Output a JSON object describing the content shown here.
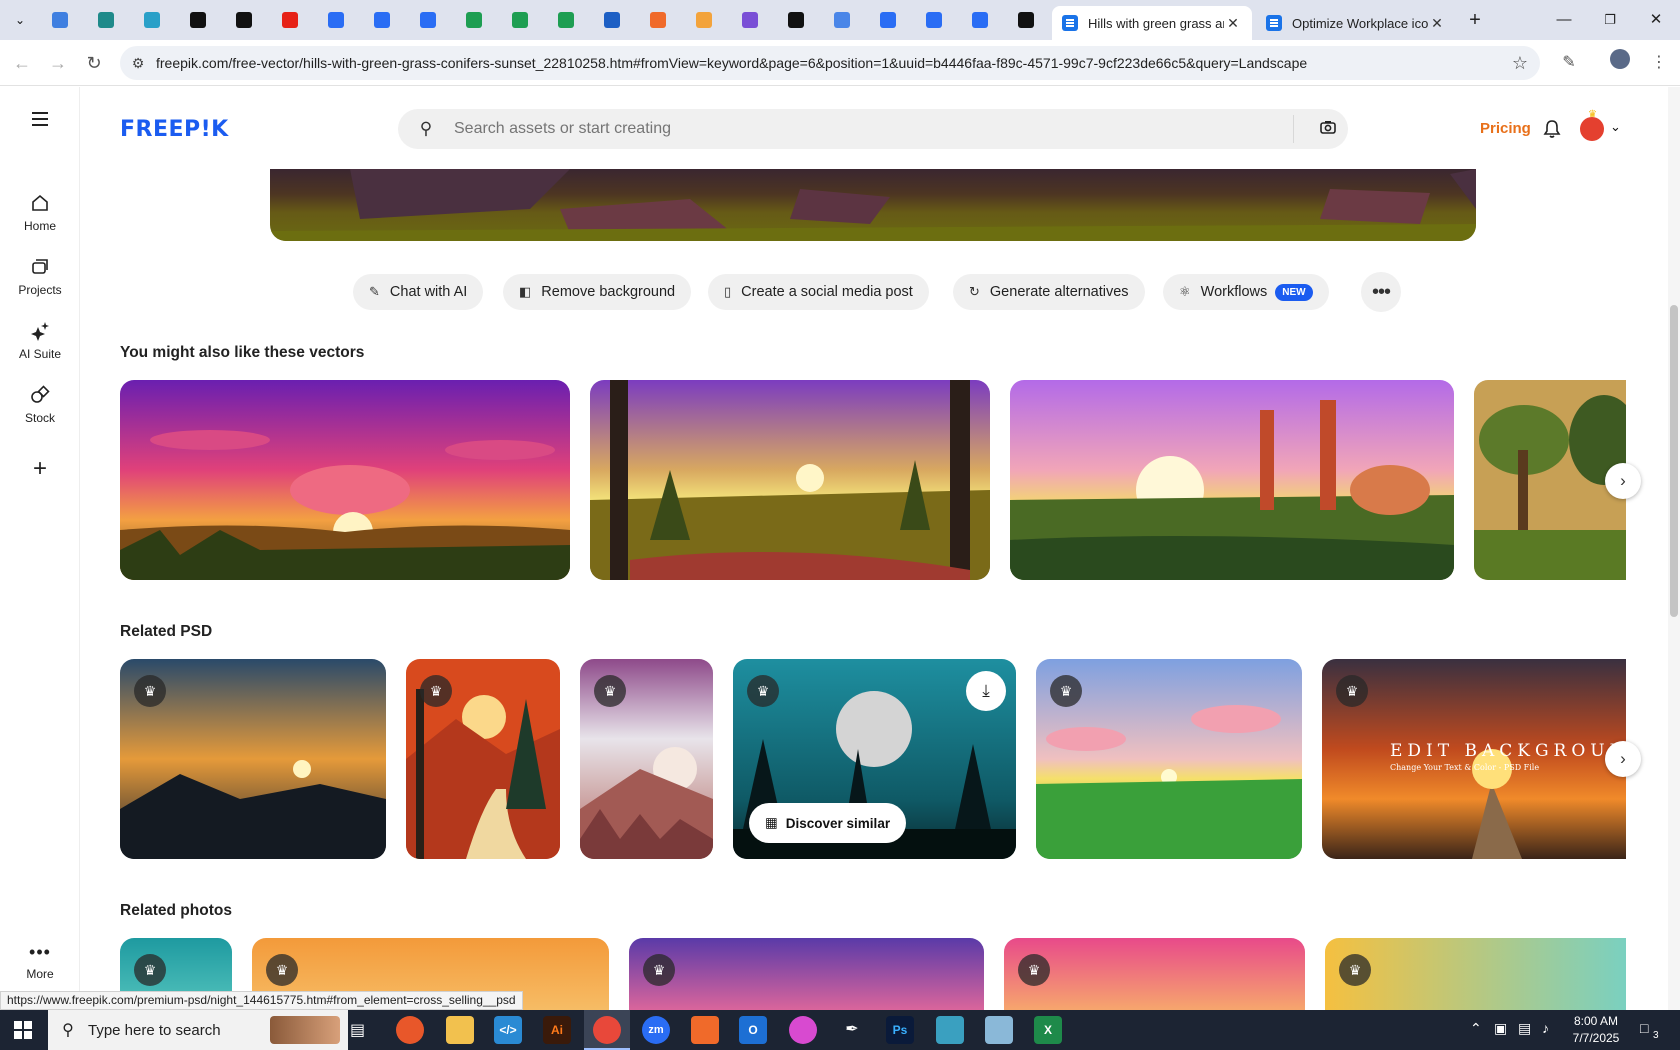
{
  "browser": {
    "pinned_tabs": [
      {
        "icon": "chrome-tab-icon",
        "color": "#3f7fe0"
      },
      {
        "icon": "vpn-shield-icon",
        "color": "#1f8a8a"
      },
      {
        "icon": "diamond-app-icon",
        "color": "#2aa0c8"
      },
      {
        "icon": "openai-icon",
        "color": "#111111"
      },
      {
        "icon": "lightning-app-icon",
        "color": "#111111"
      },
      {
        "icon": "youtube-icon",
        "color": "#e62117"
      },
      {
        "icon": "google-docs-icon",
        "color": "#2a6df4"
      },
      {
        "icon": "google-docs-icon",
        "color": "#2a6df4"
      },
      {
        "icon": "google-docs-icon",
        "color": "#2a6df4"
      },
      {
        "icon": "google-sheets-icon",
        "color": "#1e9e52"
      },
      {
        "icon": "google-sheets-icon",
        "color": "#1e9e52"
      },
      {
        "icon": "google-sheets-icon",
        "color": "#1e9e52"
      },
      {
        "icon": "word-app-icon",
        "color": "#1d5fc4"
      },
      {
        "icon": "boxed-app-icon",
        "color": "#f06a2a"
      },
      {
        "icon": "bookmark-ribbon-icon",
        "color": "#f3a33b"
      },
      {
        "icon": "braces-app-icon",
        "color": "#7a4fd6"
      },
      {
        "icon": "tech-app-icon",
        "color": "#111111"
      },
      {
        "icon": "grid-app-icon",
        "color": "#4a86e8"
      },
      {
        "icon": "forms-app-icon",
        "color": "#2a6df4"
      },
      {
        "icon": "forms-app-icon",
        "color": "#2a6df4"
      },
      {
        "icon": "forms-app-icon",
        "color": "#2a6df4"
      },
      {
        "icon": "medium-icon",
        "color": "#111111"
      }
    ],
    "tabs": [
      {
        "title": "Hills with green grass and",
        "active": true
      },
      {
        "title": "Optimize Workplace icon",
        "active": false
      }
    ],
    "new_tab": "+",
    "url": "freepik.com/free-vector/hills-with-green-grass-conifers-sunset_22810258.htm#fromView=keyword&page=6&position=1&uuid=b4446faa-f89c-4571-99c7-9cf223de66c5&query=Landscape",
    "status_url": "https://www.freepik.com/premium-psd/night_144615775.htm#from_element=cross_selling__psd"
  },
  "sidebar": {
    "items": [
      {
        "label": "Home",
        "icon": "home-icon"
      },
      {
        "label": "Projects",
        "icon": "projects-icon"
      },
      {
        "label": "AI Suite",
        "icon": "sparkle-icon"
      },
      {
        "label": "Stock",
        "icon": "shapes-icon"
      }
    ],
    "add": "+",
    "more_label": "More"
  },
  "header": {
    "logo": "FREEP!K",
    "search_placeholder": "Search assets or start creating",
    "pricing": "Pricing"
  },
  "actions": [
    {
      "label": "Chat with AI",
      "icon": "chat-edit-icon"
    },
    {
      "label": "Remove background",
      "icon": "remove-bg-icon"
    },
    {
      "label": "Create a social media post",
      "icon": "phone-icon"
    },
    {
      "label": "Generate alternatives",
      "icon": "refresh-icon"
    },
    {
      "label": "Workflows",
      "icon": "workflow-icon",
      "badge": "NEW"
    }
  ],
  "vectors_section": {
    "title": "You might also like these vectors"
  },
  "psd_section": {
    "title": "Related PSD",
    "hover_card": {
      "discover_label": "Discover similar"
    },
    "banner_text": "EDIT BACKGROUND",
    "banner_subtext": "Change Your Text & Color - PSD File"
  },
  "photos_section": {
    "title": "Related photos"
  },
  "taskbar": {
    "search_placeholder": "Type here to search",
    "time": "8:00 AM",
    "date": "7/7/2025",
    "notification_count": "3"
  },
  "colors": {
    "brand": "#1b5cf0",
    "pricing": "#e8701a",
    "badge": "#1b5cf0"
  }
}
